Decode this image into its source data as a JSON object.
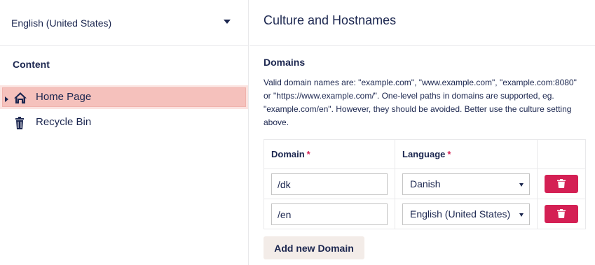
{
  "language_picker": {
    "value": "English (United States)"
  },
  "tree": {
    "title": "Content",
    "items": [
      {
        "label": "Home Page",
        "icon": "home-icon",
        "selected": true
      },
      {
        "label": "Recycle Bin",
        "icon": "trash-icon",
        "selected": false
      }
    ]
  },
  "panel": {
    "title": "Culture and Hostnames",
    "domains_heading": "Domains",
    "description": "Valid domain names are: \"example.com\", \"www.example.com\", \"example.com:8080\" or \"https://www.example.com/\". One-level paths in domains are supported, eg. \"example.com/en\". However, they should be avoided. Better use the culture setting above.",
    "table": {
      "headers": {
        "domain": "Domain",
        "language": "Language",
        "required_mark": "*"
      },
      "rows": [
        {
          "domain": "/dk",
          "language": "Danish"
        },
        {
          "domain": "/en",
          "language": "English (United States)"
        }
      ]
    },
    "add_button": "Add new Domain"
  },
  "colors": {
    "accent": "#d42054",
    "selected_bg": "#f5c1bc",
    "text": "#1b264f"
  }
}
